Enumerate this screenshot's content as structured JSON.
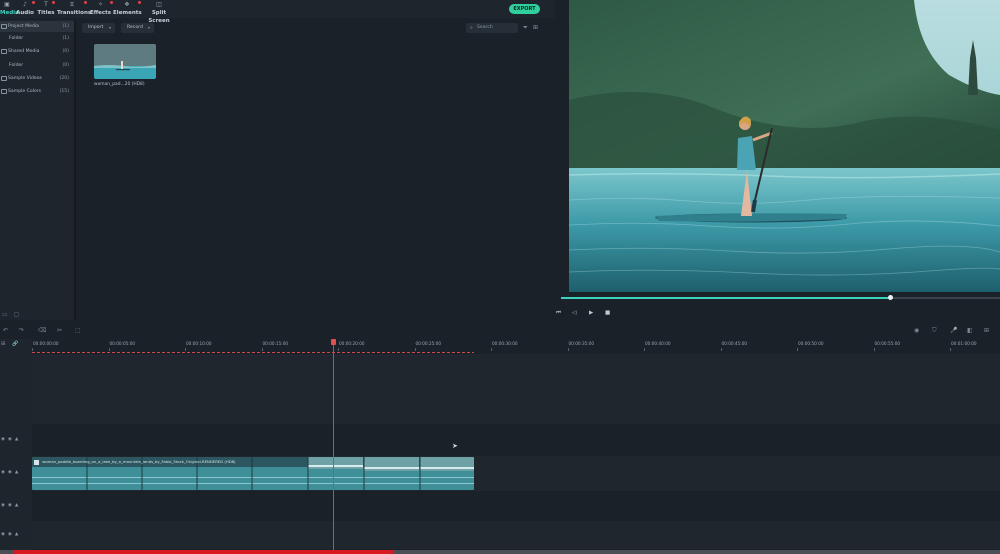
{
  "toolbar": {
    "tabs": [
      {
        "label": "Media",
        "icon": "media-icon"
      },
      {
        "label": "Audio",
        "icon": "audio-icon"
      },
      {
        "label": "Titles",
        "icon": "titles-icon"
      },
      {
        "label": "Transitions",
        "icon": "transitions-icon"
      },
      {
        "label": "Effects",
        "icon": "effects-icon"
      },
      {
        "label": "Elements",
        "icon": "elements-icon"
      },
      {
        "label": "Split Screen",
        "icon": "split-screen-icon"
      }
    ],
    "export_label": "EXPORT"
  },
  "library": {
    "items": [
      {
        "label": "Project Media",
        "count": "(1)"
      },
      {
        "label": "Folder",
        "count": "(1)"
      },
      {
        "label": "Shared Media",
        "count": "(0)"
      },
      {
        "label": "Folder",
        "count": "(0)"
      },
      {
        "label": "Sample Videos",
        "count": "(20)"
      },
      {
        "label": "Sample Colors",
        "count": "(15)"
      }
    ]
  },
  "media": {
    "import_label": "Import",
    "record_label": "Record",
    "search_placeholder": "Search",
    "thumbnail_caption": "woman_pad...20 (HD8)"
  },
  "timeline": {
    "ruler_ticks": [
      "00:00:00:00",
      "00:00:05:00",
      "00:00:10:00",
      "00:00:15:00",
      "00:00:20:00",
      "00:00:25:00",
      "00:00:30:00",
      "00:00:35:00",
      "00:00:40:00",
      "00:00:45:00",
      "00:00:50:00",
      "00:00:55:00",
      "00:01:00:00"
    ],
    "clip_title": "woman_paddle_boarding_on_a_lake_by_a_mountain_lands_by_Fabio_Stock_Original-RENDERED (HD8)"
  },
  "video_progress": 0.385,
  "scrub_progress": 0.749,
  "colors": {
    "accent": "#39d3c0",
    "export": "#2fcf9e",
    "playhead": "#cf4545",
    "progress": "#d71921"
  }
}
